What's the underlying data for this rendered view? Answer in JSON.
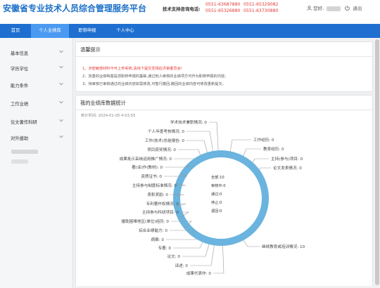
{
  "header": {
    "title": "安徽省专业技术人员综合管理服务平台",
    "support_label": "技术支持咨询电话:",
    "phones": [
      "0551-63687880",
      "0551-65329082",
      "0551-65326880",
      "0551-63730880"
    ],
    "greeting": "您好,",
    "logout": "退出"
  },
  "nav": {
    "tabs": [
      {
        "label": "首页",
        "active": false
      },
      {
        "label": "个人业绩库",
        "active": true
      },
      {
        "label": "职称申报",
        "active": false
      },
      {
        "label": "个人中心",
        "active": false
      }
    ]
  },
  "sidebar": {
    "items": [
      {
        "label": "基本信息"
      },
      {
        "label": "学历学位"
      },
      {
        "label": "能力条件"
      },
      {
        "label": "工作业绩"
      },
      {
        "label": "论文著作科研"
      },
      {
        "label": "对外援助"
      }
    ]
  },
  "notice": {
    "title": "温馨提示",
    "lines": [
      "1、涉密敏感材料不可上传系统,请线下提交至相应评审委员会!",
      "2、完善的业绩档案是您职称申报的基础,通过他人审核的业绩项方可作为职称申报的内容。",
      "3、待审核已审核通过的业绩内容如需修改,可暂行撤回,撤回的业绩内容可修改重新提交。"
    ]
  },
  "stats": {
    "title": "我的业绩库数据统计",
    "time_label": "统计时间: 2024-01-05 4:03:55",
    "center": [
      "全部:10",
      "审核中:0",
      "通过:0",
      "停止:0",
      "退回:0"
    ]
  },
  "chart_data": {
    "type": "pie",
    "title": "",
    "slices": [
      {
        "name": "学术技术兼职情况",
        "value": 0
      },
      {
        "name": "工作经历",
        "value": 0
      },
      {
        "name": "教育经历",
        "value": 0
      },
      {
        "name": "主持(参与)项目",
        "value": 0
      },
      {
        "name": "论文发表情况",
        "value": 0
      },
      {
        "name": "继续教育或培训情况",
        "value": 10
      },
      {
        "name": "成果代表作",
        "value": 0
      },
      {
        "name": "译述",
        "value": 0
      },
      {
        "name": "论文",
        "value": 0
      },
      {
        "name": "专著",
        "value": 0
      },
      {
        "name": "病案",
        "value": 0
      },
      {
        "name": "综合业绩能力",
        "value": 0
      },
      {
        "name": "援助困难地区(单位)经历",
        "value": 0
      },
      {
        "name": "主持参与科研项目",
        "value": 0
      },
      {
        "name": "专利著作权情况",
        "value": 0
      },
      {
        "name": "表彰奖励",
        "value": 0
      },
      {
        "name": "主持参与制度标准情况",
        "value": 0
      },
      {
        "name": "资质证书",
        "value": 0
      },
      {
        "name": "著(译)作(教材)",
        "value": 0
      },
      {
        "name": "成果批示采纳运用推广情况",
        "value": 0
      },
      {
        "name": "项目获奖情况",
        "value": 0
      },
      {
        "name": "工作(技术)总结报告",
        "value": 0
      },
      {
        "name": "个人年度考核情况",
        "value": 0
      }
    ],
    "colors": {
      "ring": "#6ab4df",
      "label_line": "#999999"
    }
  }
}
